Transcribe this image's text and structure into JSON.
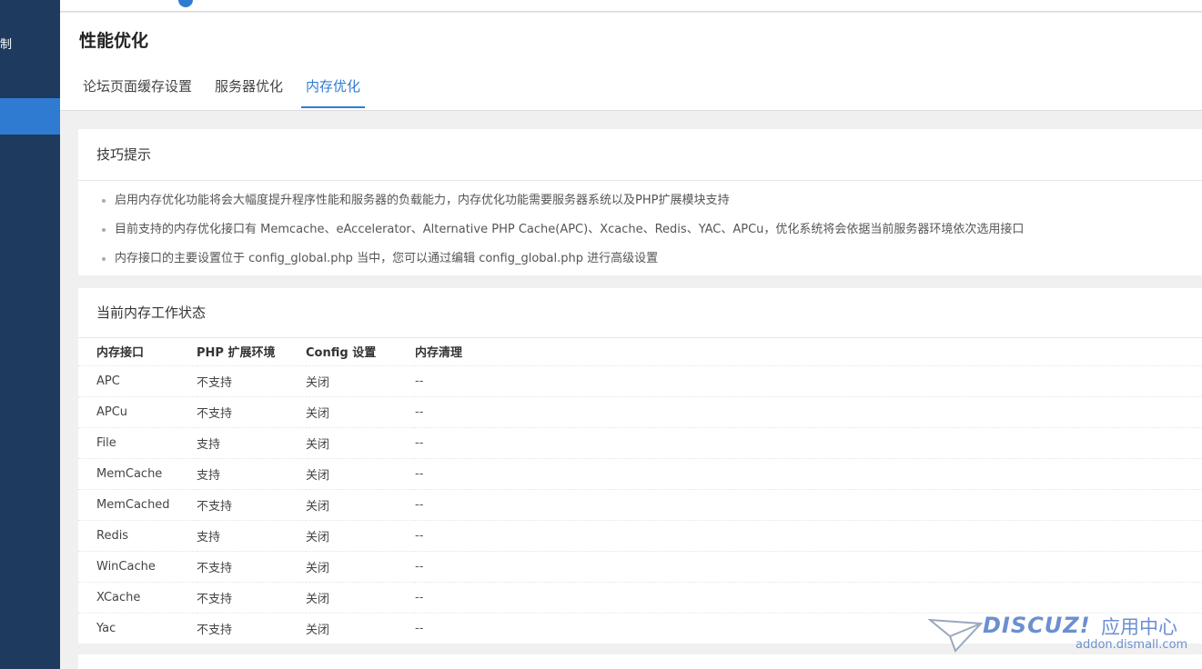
{
  "sidebar": {
    "items": [
      {
        "label": "制"
      },
      {
        "label": ""
      }
    ]
  },
  "header": {
    "title": "性能优化",
    "tabs": [
      {
        "label": "论坛页面缓存设置",
        "active": false
      },
      {
        "label": "服务器优化",
        "active": false
      },
      {
        "label": "内存优化",
        "active": true
      }
    ]
  },
  "tips": {
    "title": "技巧提示",
    "items": [
      "启用内存优化功能将会大幅度提升程序性能和服务器的负载能力，内存优化功能需要服务器系统以及PHP扩展模块支持",
      "目前支持的内存优化接口有 Memcache、eAccelerator、Alternative PHP Cache(APC)、Xcache、Redis、YAC、APCu，优化系统将会依据当前服务器环境依次选用接口",
      "内存接口的主要设置位于 config_global.php 当中，您可以通过编辑 config_global.php 进行高级设置"
    ]
  },
  "status": {
    "title": "当前内存工作状态",
    "columns": [
      "内存接口",
      "PHP 扩展环境",
      "Config 设置",
      "内存清理"
    ],
    "rows": [
      [
        "APC",
        "不支持",
        "关闭",
        "--"
      ],
      [
        "APCu",
        "不支持",
        "关闭",
        "--"
      ],
      [
        "File",
        "支持",
        "关闭",
        "--"
      ],
      [
        "MemCache",
        "支持",
        "关闭",
        "--"
      ],
      [
        "MemCached",
        "不支持",
        "关闭",
        "--"
      ],
      [
        "Redis",
        "支持",
        "关闭",
        "--"
      ],
      [
        "WinCache",
        "不支持",
        "关闭",
        "--"
      ],
      [
        "XCache",
        "不支持",
        "关闭",
        "--"
      ],
      [
        "Yac",
        "不支持",
        "关闭",
        "--"
      ]
    ]
  },
  "watermark": {
    "logo": "DISCUZ!",
    "cn": "应用中心",
    "url": "addon.dismall.com"
  },
  "colors": {
    "sidebar_bg": "#1e3a5f",
    "accent": "#2f7bd1"
  }
}
